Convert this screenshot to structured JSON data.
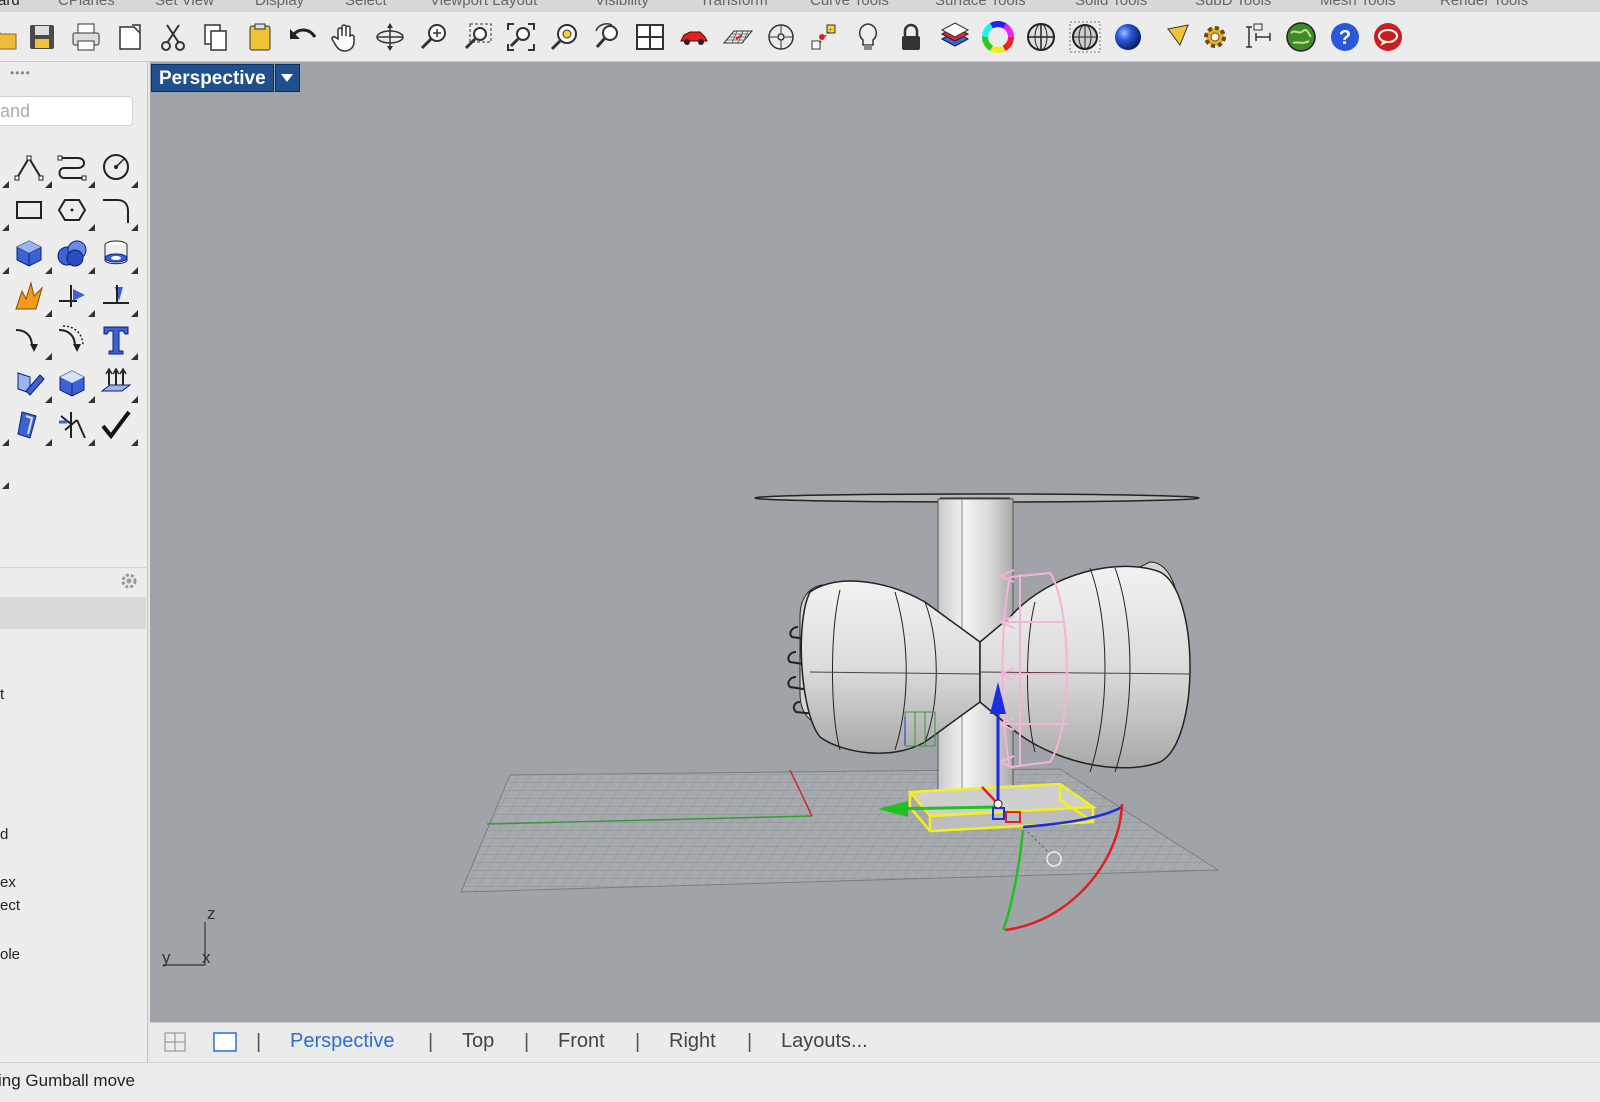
{
  "menu_tabs": [
    "ard",
    "CPlanes",
    "Set View",
    "Display",
    "Select",
    "Viewport Layout",
    "Visibility",
    "Transform",
    "Curve Tools",
    "Surface Tools",
    "Solid Tools",
    "SubD Tools",
    "Mesh Tools",
    "Render Tools"
  ],
  "toolbar": {
    "icons": [
      "open-icon",
      "save-icon",
      "print-icon",
      "import-icon",
      "cut-icon",
      "copy-icon",
      "paste-icon",
      "undo-icon",
      "pan-icon",
      "rotate-view-icon",
      "zoom-icon",
      "zoom-window-icon",
      "zoom-extents-icon",
      "zoom-selected-icon",
      "rotate-camera-icon",
      "four-viewports-icon",
      "car-icon",
      "grid-icon",
      "point-icon",
      "control-points-icon",
      "light-bulb-icon",
      "lock-icon",
      "layer-icon",
      "color-wheel-icon",
      "wireframe-sphere-icon",
      "ghosted-sphere-icon",
      "rendered-sphere-icon",
      "pick-icon",
      "settings-gear-icon",
      "dimension-icon",
      "rhino-globe-icon",
      "help-icon",
      "chat-icon"
    ]
  },
  "left_panel": {
    "grip": "••••",
    "command_placeholder": "and",
    "side_labels": [
      "t",
      "d",
      "ex",
      "ect",
      "ole"
    ]
  },
  "viewport": {
    "title": "Perspective",
    "axis_z": "z",
    "axis_y": "y",
    "axis_x": "x"
  },
  "bottom_tabs": {
    "perspective": "Perspective",
    "top": "Top",
    "front": "Front",
    "right": "Right",
    "layouts": "Layouts..."
  },
  "status": {
    "message": "ing Gumball move"
  },
  "colors": {
    "viewport_bg": "#a0a4a9",
    "title_bg": "#1f4f8d",
    "active_tab": "#2b6fd6",
    "gumball_x": "#e02020",
    "gumball_y": "#20c020",
    "gumball_z": "#1a2ee0",
    "selection": "#f2f21a"
  }
}
